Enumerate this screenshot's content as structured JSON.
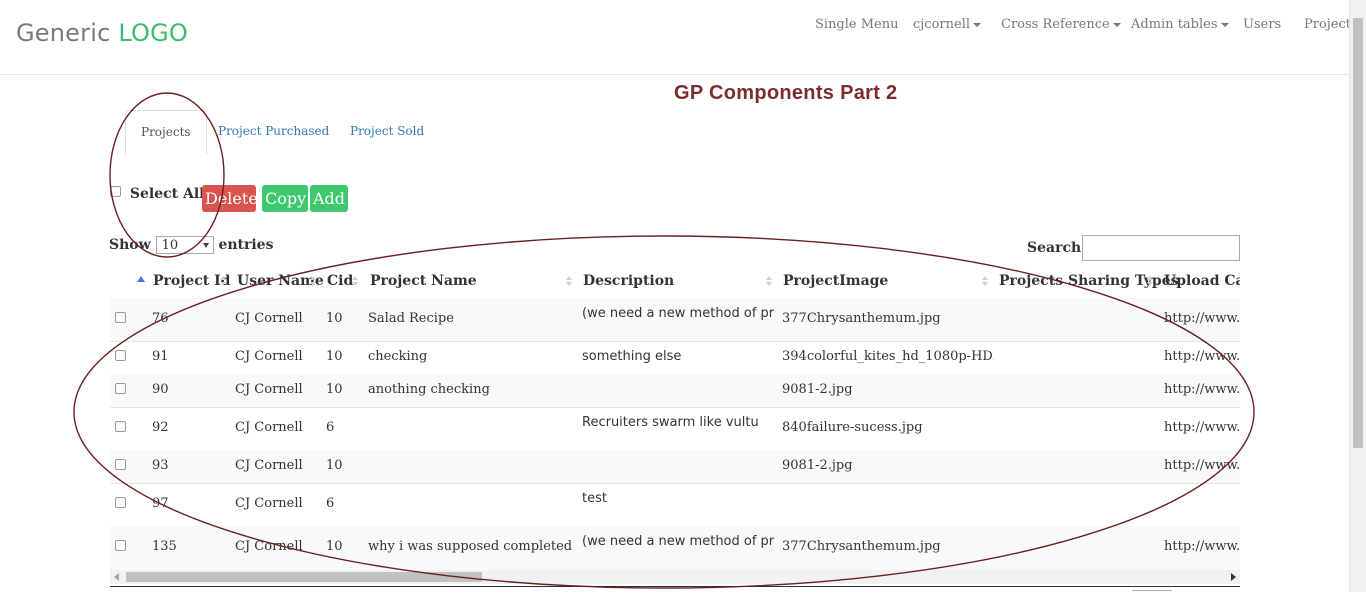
{
  "header": {
    "logo_text": "Generic",
    "logo_accent": "LOGO",
    "nav": {
      "single_menu": "Single Menu",
      "user": "cjcornell",
      "cross_reference": "Cross Reference",
      "admin_tables": "Admin tables",
      "users": "Users",
      "projects": "Projects"
    }
  },
  "page": {
    "title": "GP Components Part 2",
    "tabs": {
      "projects": "Projects",
      "purchased": "Project Purchased",
      "sold": "Project Sold"
    }
  },
  "actions": {
    "select_all": "Select All",
    "delete": "Delete",
    "copy": "Copy",
    "add": "Add"
  },
  "table_controls": {
    "show": "Show",
    "length_value": "10",
    "entries": "entries",
    "search_label": "Search:"
  },
  "table": {
    "columns": {
      "project_id": "Project Id",
      "user_name": "User Name",
      "cid": "Cid",
      "project_name": "Project Name",
      "description": "Description",
      "project_image": "ProjectImage",
      "sharing_types": "Projects Sharing Types",
      "upload_care": "Upload Care"
    },
    "rows": [
      {
        "id": "76",
        "user": "CJ Cornell",
        "cid": "10",
        "name": "Salad Recipe",
        "desc": "(we need a new method of pr",
        "image": "377Chrysanthemum.jpg",
        "sharing": "",
        "upload": "http://www."
      },
      {
        "id": "91",
        "user": "CJ Cornell",
        "cid": "10",
        "name": "checking",
        "desc": "something else",
        "image": "394colorful_kites_hd_1080p-HD.",
        "sharing": "",
        "upload": "http://www."
      },
      {
        "id": "90",
        "user": "CJ Cornell",
        "cid": "10",
        "name": "anothing checking",
        "desc": "",
        "image": "9081-2.jpg",
        "sharing": "",
        "upload": "http://www."
      },
      {
        "id": "92",
        "user": "CJ Cornell",
        "cid": "6",
        "name": "",
        "desc": "Recruiters swarm like vultu",
        "image": "840failure-sucess.jpg",
        "sharing": "",
        "upload": "http://www."
      },
      {
        "id": "93",
        "user": "CJ Cornell",
        "cid": "10",
        "name": "",
        "desc": "",
        "image": "9081-2.jpg",
        "sharing": "",
        "upload": "http://www."
      },
      {
        "id": "97",
        "user": "CJ Cornell",
        "cid": "6",
        "name": "",
        "desc": "test",
        "image": "",
        "sharing": "",
        "upload": ""
      },
      {
        "id": "135",
        "user": "CJ Cornell",
        "cid": "10",
        "name": "why i was supposed completed d",
        "desc": "(we need a new method of pr",
        "image": "377Chrysanthemum.jpg",
        "sharing": "",
        "upload": "http://www."
      }
    ]
  },
  "colors": {
    "logo_accent": "#3cbc6c",
    "title": "#7b2d2d",
    "delete_button": "#d9534f",
    "copy_add_buttons": "#3ec86f",
    "link": "#337ab7",
    "annotation_ellipse": "#6b1f1f"
  }
}
